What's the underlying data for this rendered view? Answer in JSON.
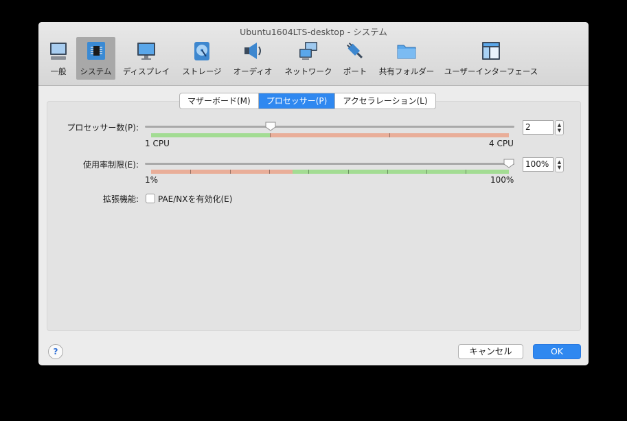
{
  "window": {
    "title": "Ubuntu1604LTS-desktop - システム"
  },
  "toolbar": {
    "items": [
      {
        "label": "一般",
        "icon": "monitor-general-icon"
      },
      {
        "label": "システム",
        "icon": "chip-system-icon",
        "active": true
      },
      {
        "label": "ディスプレイ",
        "icon": "display-icon"
      },
      {
        "label": "ストレージ",
        "icon": "storage-disk-icon"
      },
      {
        "label": "オーディオ",
        "icon": "speaker-audio-icon"
      },
      {
        "label": "ネットワーク",
        "icon": "network-icon"
      },
      {
        "label": "ポート",
        "icon": "port-plug-icon"
      },
      {
        "label": "共有フォルダー",
        "icon": "shared-folder-icon"
      },
      {
        "label": "ユーザーインターフェース",
        "icon": "user-interface-icon"
      }
    ]
  },
  "tabs": [
    {
      "label": "マザーボード(M)"
    },
    {
      "label": "プロセッサー(P)",
      "active": true
    },
    {
      "label": "アクセラレーション(L)"
    }
  ],
  "processor": {
    "cpu_count_label": "プロセッサー数(P):",
    "cpu_count_value": "2",
    "cpu_min_label": "1 CPU",
    "cpu_max_label": "4 CPU",
    "cpu_slider_value": 2,
    "cpu_slider_min": 1,
    "cpu_slider_max": 4,
    "exec_cap_label": "使用率制限(E):",
    "exec_cap_value": "100%",
    "exec_cap_min_label": "1%",
    "exec_cap_max_label": "100%",
    "exec_cap_slider_fraction": 1.0,
    "ext_features_label": "拡張機能:",
    "pae_nx_label": "PAE/NXを有効化(E)",
    "pae_nx_checked": false
  },
  "footer": {
    "help_label": "?",
    "cancel_label": "キャンセル",
    "ok_label": "OK"
  },
  "colors": {
    "accent": "#2f88f0",
    "green_zone": "#9fdb8f",
    "red_zone": "#e8aa95"
  }
}
